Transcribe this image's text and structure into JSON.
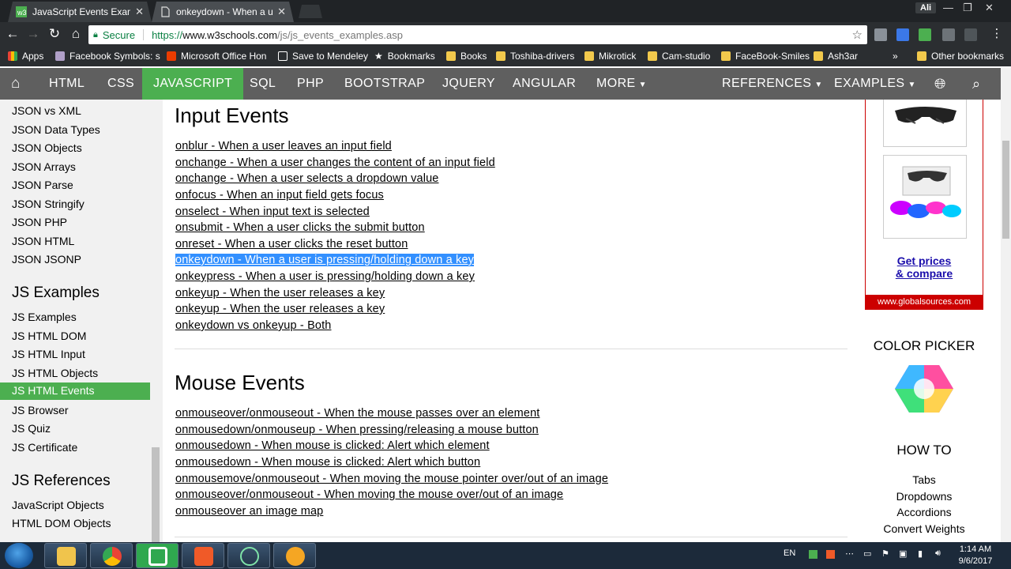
{
  "browser": {
    "tabs": [
      {
        "title": "JavaScript Events Exampl",
        "active": false
      },
      {
        "title": "onkeydown - When a us",
        "active": true
      }
    ],
    "window_badge": "Ali",
    "url": {
      "secure_label": "Secure",
      "scheme": "https://",
      "host": "www.w3schools.com",
      "path": "/js/js_events_examples.asp"
    },
    "bookmarks": [
      "Apps",
      "Facebook Symbols: s",
      "Microsoft Office Hon",
      "Save to Mendeley",
      "Bookmarks",
      "Books",
      "Toshiba-drivers",
      "Mikrotick",
      "Cam-studio",
      "FaceBook-Smiles",
      "Ash3ar"
    ],
    "other_bookmarks": "Other bookmarks",
    "more_bookmarks": "»"
  },
  "nav": {
    "items": [
      "HTML",
      "CSS",
      "JAVASCRIPT",
      "SQL",
      "PHP",
      "BOOTSTRAP",
      "JQUERY",
      "ANGULAR",
      "MORE"
    ],
    "right_items": [
      "REFERENCES",
      "EXAMPLES"
    ],
    "active": "JAVASCRIPT"
  },
  "sidebar": {
    "json_links": [
      "JSON vs XML",
      "JSON Data Types",
      "JSON Objects",
      "JSON Arrays",
      "JSON Parse",
      "JSON Stringify",
      "JSON PHP",
      "JSON HTML",
      "JSON JSONP"
    ],
    "examples_heading": "JS Examples",
    "example_links": [
      "JS Examples",
      "JS HTML DOM",
      "JS HTML Input",
      "JS HTML Objects",
      "JS HTML Events",
      "JS Browser",
      "JS Quiz",
      "JS Certificate"
    ],
    "active_link": "JS HTML Events",
    "references_heading": "JS References",
    "reference_links": [
      "JavaScript Objects",
      "HTML DOM Objects"
    ]
  },
  "main": {
    "input_events": {
      "heading": "Input Events",
      "links": [
        "onblur - When a user leaves an input field",
        "onchange - When a user changes the content of an input field",
        "onchange - When a user selects a dropdown value",
        "onfocus - When an input field gets focus",
        "onselect - When input text is selected",
        "onsubmit - When a user clicks the submit button",
        "onreset - When a user clicks the reset button",
        "onkeydown - When a user is pressing/holding down a key",
        "onkeypress - When a user is pressing/holding down a key",
        "onkeyup - When the user releases a key",
        "onkeyup - When the user releases a key",
        "onkeydown vs onkeyup - Both"
      ],
      "selected_index": 7
    },
    "mouse_events": {
      "heading": "Mouse Events",
      "links": [
        "onmouseover/onmouseout - When the mouse passes over an element",
        "onmousedown/onmouseup - When pressing/releasing a mouse button",
        "onmousedown - When mouse is clicked: Alert which element",
        "onmousedown - When mouse is clicked: Alert which button",
        "onmousemove/onmouseout - When moving the mouse pointer over/out of an image",
        "onmouseover/onmouseout - When moving the mouse over/out of an image",
        "onmouseover an image map"
      ]
    }
  },
  "right": {
    "ad_link": "Get prices & compare",
    "ad_link_line1": "Get prices",
    "ad_link_line2": "& compare",
    "ad_footer": "www.globalsources.com",
    "color_picker_heading": "COLOR PICKER",
    "howto_heading": "HOW TO",
    "howto_links": [
      "Tabs",
      "Dropdowns",
      "Accordions",
      "Convert Weights"
    ]
  },
  "taskbar": {
    "language": "EN",
    "time": "1:14 AM",
    "date": "9/6/2017"
  },
  "colors": {
    "w3_green": "#4caf50",
    "nav_gray": "#5f5f5f",
    "selection": "#3390ff",
    "ad_red": "#cc0000"
  }
}
